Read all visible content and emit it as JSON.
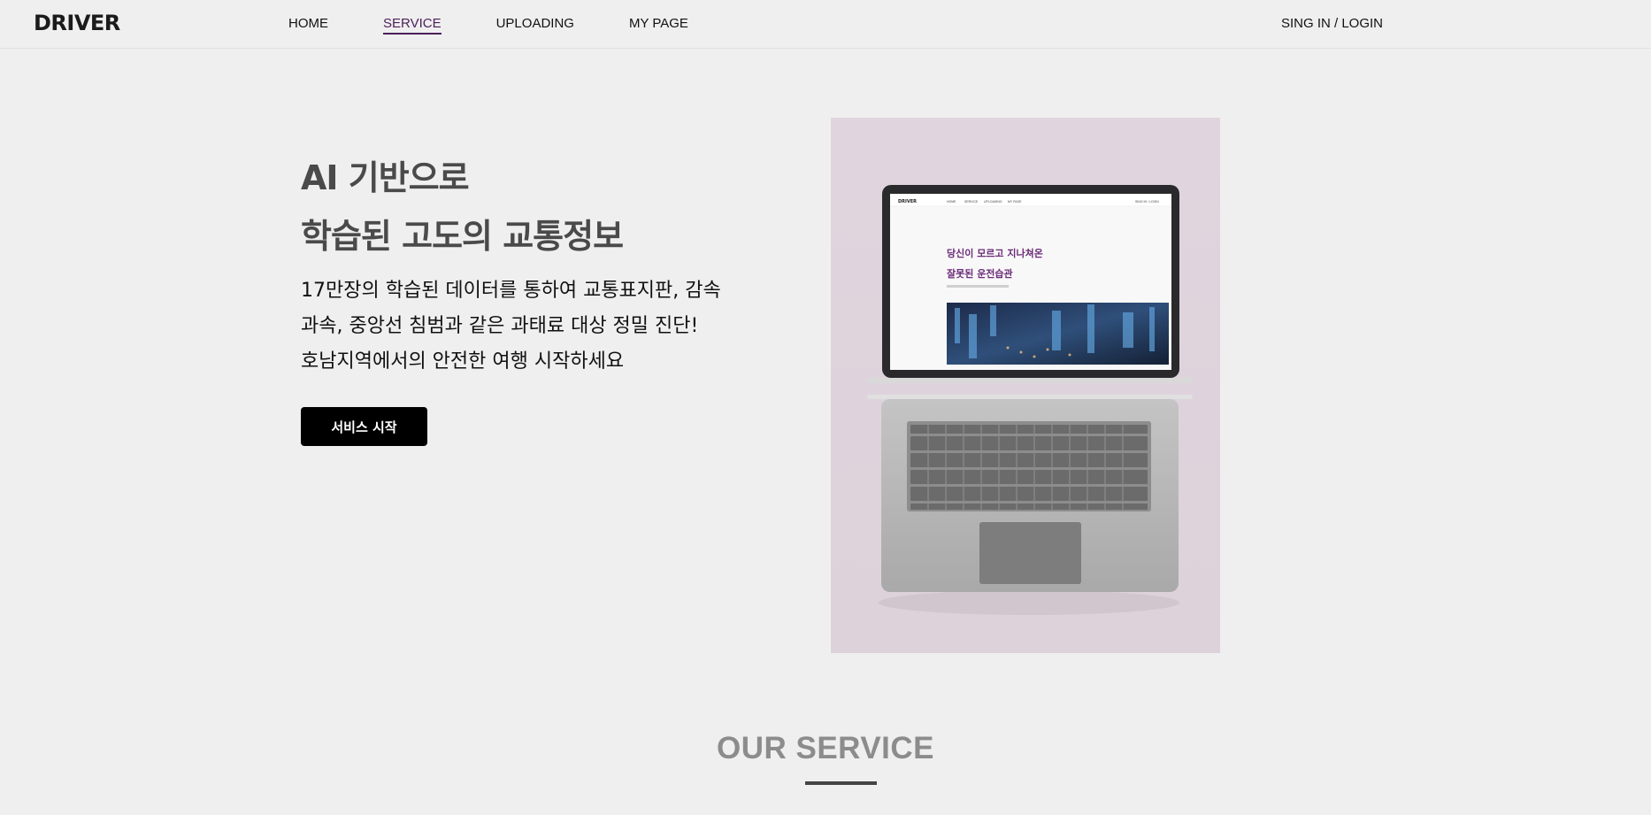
{
  "nav": {
    "logo": "DRIVER",
    "items": [
      "HOME",
      "SERVICE",
      "UPLOADING",
      "MY PAGE"
    ],
    "active": "SERVICE",
    "signin": "SING IN / LOGIN"
  },
  "hero": {
    "title_line1": "AI 기반으로",
    "title_line2": "학습된 고도의 교통정보",
    "desc_line1": "17만장의 학습된 데이터를 통하여 교통표지판, 감속",
    "desc_line2": "과속, 중앙선 침범과 같은 과태료 대상 정밀 진단!",
    "desc_line3": "호남지역에서의 안전한 여행 시작하세요",
    "cta": "서비스 시작"
  },
  "laptop_screen": {
    "logo": "DRIVER",
    "menu": [
      "HOME",
      "SERVICE",
      "UPLOADING",
      "MY PAGE"
    ],
    "signin": "SING IN / LOGIN",
    "headline_line1": "당신이 모르고 지나쳐온",
    "headline_line2": "잘못된 운전습관"
  },
  "colors": {
    "accent": "#4b1f59",
    "background": "#efefef",
    "image_bg": "#e0d5de"
  },
  "section": {
    "title": "OUR SERVICE"
  }
}
